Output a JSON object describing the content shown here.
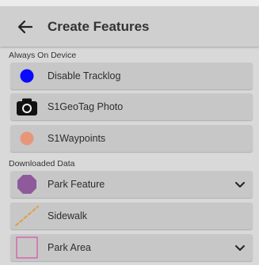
{
  "header": {
    "title": "Create Features",
    "back_icon": "arrow-left-icon"
  },
  "sections": [
    {
      "label": "Always On Device",
      "items": [
        {
          "label": "Disable Tracklog",
          "icon": "blue-dot-icon",
          "color": "#0a0aff"
        },
        {
          "label": "S1GeoTag Photo",
          "icon": "camera-icon",
          "color": "#111111"
        },
        {
          "label": "S1Waypoints",
          "icon": "orange-dot-icon",
          "color": "#e8967a"
        }
      ]
    },
    {
      "label": "Downloaded Data",
      "items": [
        {
          "label": "Park Feature",
          "icon": "purple-octagon-icon",
          "color": "#8e5a9c",
          "expandable": true
        },
        {
          "label": "Sidewalk",
          "icon": "orange-dashed-line-icon",
          "color": "#e0a040"
        },
        {
          "label": "Park Area",
          "icon": "pink-square-outline-icon",
          "color": "#d65aa6",
          "expandable": true
        }
      ]
    }
  ]
}
